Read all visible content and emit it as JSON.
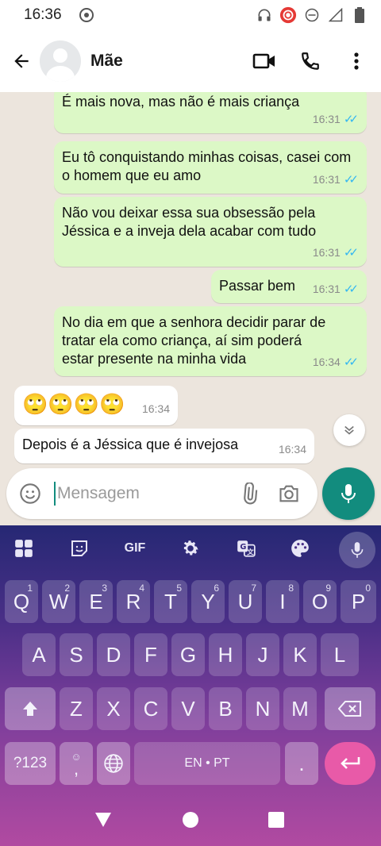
{
  "status_bar": {
    "time": "16:36"
  },
  "header": {
    "contact_name": "Mãe"
  },
  "messages": [
    {
      "text": "É mais nova, mas não é mais criança",
      "time": "16:31",
      "direction": "out"
    },
    {
      "text": "Eu tô conquistando minhas coisas, casei com o homem que eu amo",
      "time": "16:31",
      "direction": "out"
    },
    {
      "text": "Não vou deixar essa sua obsessão pela Jéssica e a inveja dela acabar com tudo",
      "time": "16:31",
      "direction": "out"
    },
    {
      "text": "Passar bem",
      "time": "16:31",
      "direction": "out"
    },
    {
      "text": "No dia em que a senhora decidir parar de tratar ela como criança, aí sim poderá estar presente na minha vida",
      "time": "16:34",
      "direction": "out"
    },
    {
      "text": "🙄🙄🙄🙄",
      "time": "16:34",
      "direction": "in"
    },
    {
      "text": "Depois é a Jéssica que é invejosa",
      "time": "16:34",
      "direction": "in"
    }
  ],
  "composer": {
    "placeholder": "Mensagem"
  },
  "keyboard": {
    "toolbar": {
      "gif_label": "GIF"
    },
    "row1": [
      {
        "key": "Q",
        "hint": "1"
      },
      {
        "key": "W",
        "hint": "2"
      },
      {
        "key": "E",
        "hint": "3"
      },
      {
        "key": "R",
        "hint": "4"
      },
      {
        "key": "T",
        "hint": "5"
      },
      {
        "key": "Y",
        "hint": "6"
      },
      {
        "key": "U",
        "hint": "7"
      },
      {
        "key": "I",
        "hint": "8"
      },
      {
        "key": "O",
        "hint": "9"
      },
      {
        "key": "P",
        "hint": "0"
      }
    ],
    "row2": [
      "A",
      "S",
      "D",
      "F",
      "G",
      "H",
      "J",
      "K",
      "L"
    ],
    "row3": [
      "Z",
      "X",
      "C",
      "V",
      "B",
      "N",
      "M"
    ],
    "symbols_label": "?123",
    "comma_label": ",",
    "space_label": "EN • PT",
    "period_label": "."
  },
  "colors": {
    "outgoing_bubble": "#dcf8c6",
    "incoming_bubble": "#ffffff",
    "accent": "#128c7e",
    "read_ticks": "#34b7f1",
    "enter_key": "#e85aa8"
  }
}
